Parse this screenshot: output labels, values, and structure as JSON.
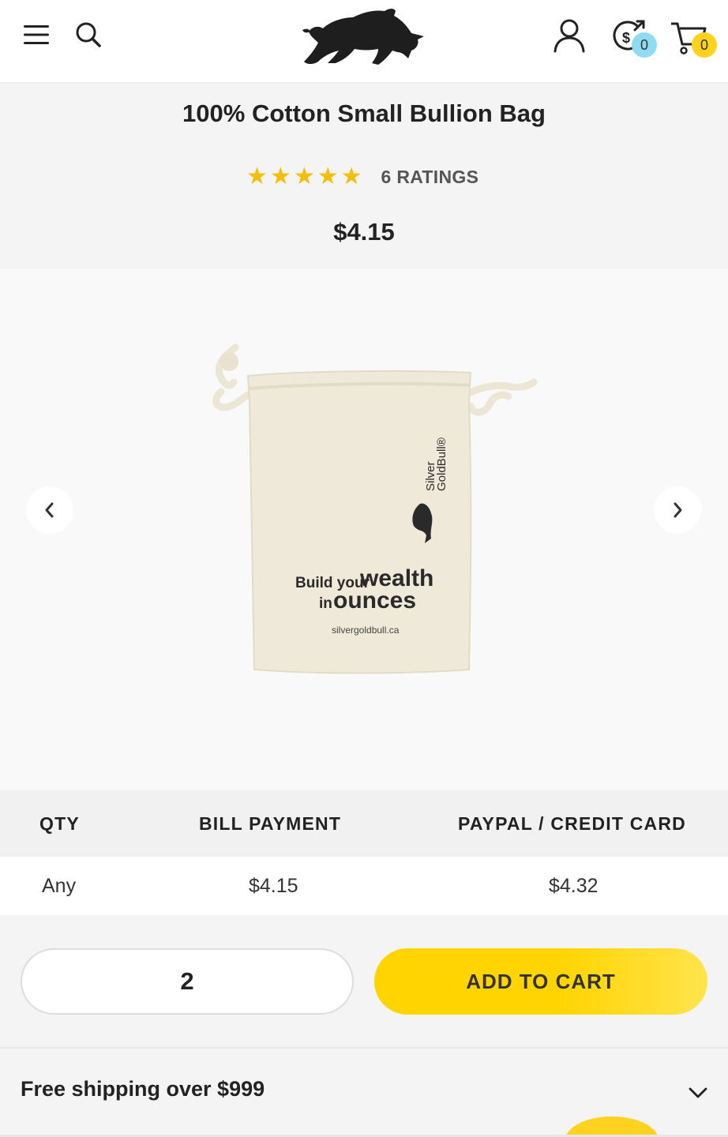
{
  "header": {
    "menu_icon": "hamburger-menu-icon",
    "search_icon": "search-icon",
    "logo_icon": "bull-logo",
    "account_icon": "user-icon",
    "sell_icon": "sell-dollar-icon",
    "sell_count": "0",
    "cart_icon": "cart-icon",
    "cart_count": "0"
  },
  "product": {
    "title": "100% Cotton Small Bullion Bag",
    "rating_stars": 5,
    "rating_label": "6 RATINGS",
    "price": "$4.15",
    "bag_brand_line1": "Silver",
    "bag_brand_line2": "GoldBull®",
    "bag_slogan_small1": "Build your",
    "bag_slogan_big1": "wealth",
    "bag_slogan_small2": "in",
    "bag_slogan_big2": "ounces",
    "bag_url": "silvergoldbull.ca"
  },
  "gallery": {
    "prev_icon": "chevron-left-icon",
    "next_icon": "chevron-right-icon"
  },
  "pricing_table": {
    "headers": [
      "QTY",
      "BILL PAYMENT",
      "PAYPAL / CREDIT CARD"
    ],
    "rows": [
      [
        "Any",
        "$4.15",
        "$4.32"
      ]
    ]
  },
  "purchase": {
    "quantity": "2",
    "add_to_cart_label": "ADD TO CART"
  },
  "shipping": {
    "label": "Free shipping over $999",
    "expand_icon": "chevron-down-icon"
  },
  "colors": {
    "accent_yellow": "#ffd400",
    "star_yellow": "#f5be0c",
    "sell_badge": "#8fdcf2"
  }
}
